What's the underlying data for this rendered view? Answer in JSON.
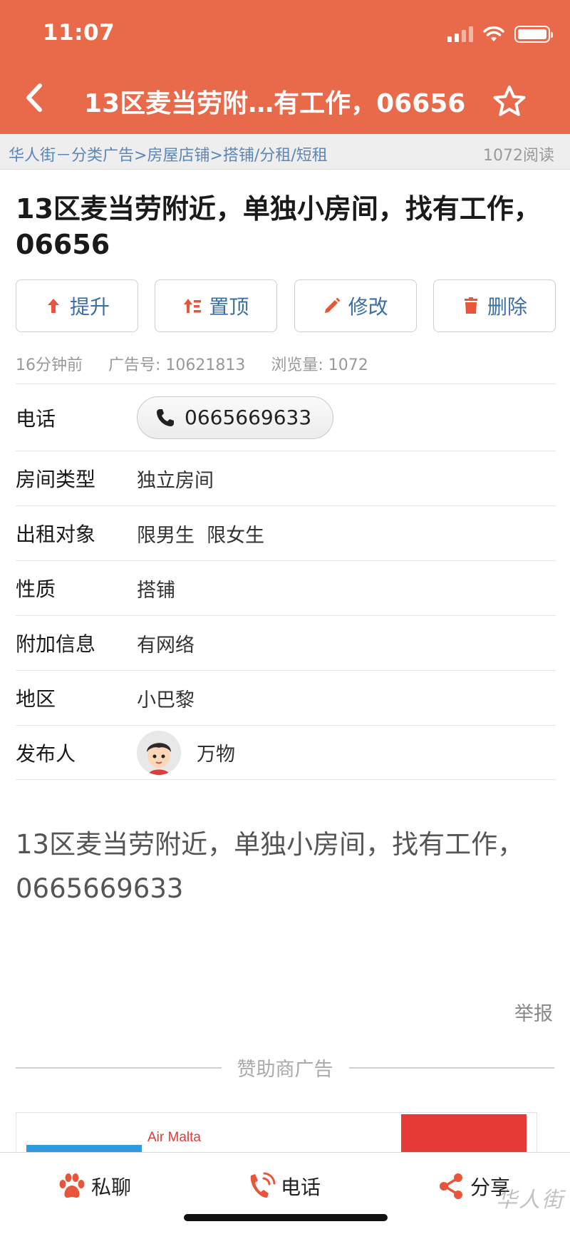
{
  "status": {
    "time": "11:07"
  },
  "nav": {
    "title": "13区麦当劳附…有工作，06656"
  },
  "breadcrumb": {
    "items": [
      "华人街－分类广告",
      "房屋店铺",
      "搭铺/分租/短租"
    ],
    "separator": ">",
    "reads": "1072阅读"
  },
  "post": {
    "title": "13区麦当劳附近，单独小房间，找有工作，06656",
    "meta": {
      "time": "16分钟前",
      "ad_no": "广告号: 10621813",
      "views": "浏览量: 1072"
    },
    "body": "13区麦当劳附近，单独小房间，找有工作，0665669633"
  },
  "actions": [
    {
      "label": "提升",
      "icon": "arrow-up-icon"
    },
    {
      "label": "置顶",
      "icon": "pin-top-icon"
    },
    {
      "label": "修改",
      "icon": "pencil-icon"
    },
    {
      "label": "删除",
      "icon": "trash-icon"
    }
  ],
  "info": {
    "phone_label": "电话",
    "phone_value": "0665669633",
    "room_type_label": "房间类型",
    "room_type_value": "独立房间",
    "tenant_label": "出租对象",
    "tenant_value": "限男生  限女生",
    "nature_label": "性质",
    "nature_value": "搭铺",
    "extra_label": "附加信息",
    "extra_value": "有网络",
    "area_label": "地区",
    "area_value": "小巴黎",
    "publisher_label": "发布人",
    "publisher_value": "万物"
  },
  "report": "举报",
  "sponsor": {
    "label": "赞助商广告",
    "ad_text": "Air Malta"
  },
  "bottom_bar": {
    "chat": "私聊",
    "call": "电话",
    "share": "分享"
  },
  "watermark": "华人街",
  "colors": {
    "brand": "#e96a4a",
    "link": "#3b6ea5",
    "accent_icon": "#e8553a"
  }
}
